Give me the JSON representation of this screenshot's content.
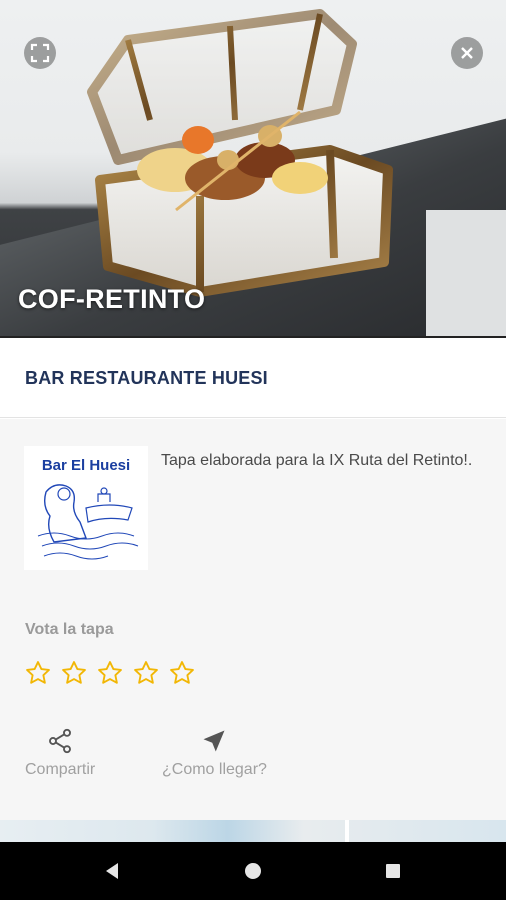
{
  "hero": {
    "title": "COF-RETINTO",
    "expand_icon": "fullscreen-icon",
    "close_icon": "close-icon"
  },
  "restaurant": {
    "name": "BAR RESTAURANTE HUESI"
  },
  "details": {
    "logo_text": "Bar El Huesi",
    "description": "Tapa elaborada para la IX Ruta del Retinto!."
  },
  "rating": {
    "label": "Vota la tapa",
    "max_stars": 5,
    "value": 0,
    "star_color": "#f2b705"
  },
  "actions": {
    "share_label": "Compartir",
    "share_icon": "share-icon",
    "directions_label": "¿Como llegar?",
    "directions_icon": "navigation-arrow-icon"
  },
  "navigation": {
    "back_icon": "back-triangle-icon",
    "home_icon": "home-circle-icon",
    "recent_icon": "recent-apps-square-icon"
  },
  "colors": {
    "title_blue": "#22345a",
    "muted_text": "#9a9a9a",
    "logo_blue": "#1b3fa0"
  }
}
